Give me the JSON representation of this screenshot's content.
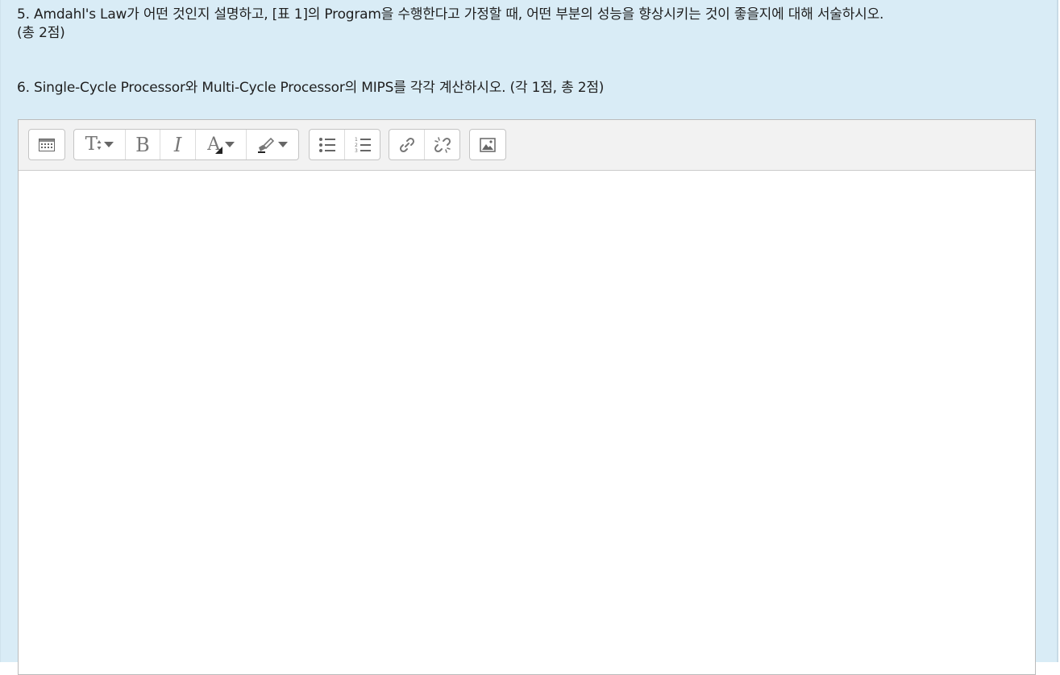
{
  "questions": {
    "q5": {
      "line1": "5. Amdahl's Law가 어떤 것인지 설명하고, [표 1]의 Program을 수행한다고 가정할 때, 어떤 부분의 성능을 향상시키는 것이 좋을지에 대해 서술하시오.",
      "line2": "(총 2점)"
    },
    "q6": {
      "line1": "6. Single-Cycle Processor와 Multi-Cycle Processor의 MIPS를 각각 계산하시오. (각 1점, 총 2점)"
    }
  },
  "editor": {
    "toolbar": {
      "groups": [
        [
          "show-more-buttons-icon"
        ],
        [
          "text-style-icon",
          "bold-icon",
          "italic-icon",
          "font-color-icon",
          "background-color-icon"
        ],
        [
          "unordered-list-icon",
          "ordered-list-icon"
        ],
        [
          "link-icon",
          "unlink-icon"
        ],
        [
          "image-icon"
        ]
      ]
    },
    "content": ""
  },
  "colors": {
    "panel_background": "#d9ecf6",
    "toolbar_background": "#f2f2f2",
    "editor_background": "#ffffff",
    "icon_gray": "#666666"
  }
}
